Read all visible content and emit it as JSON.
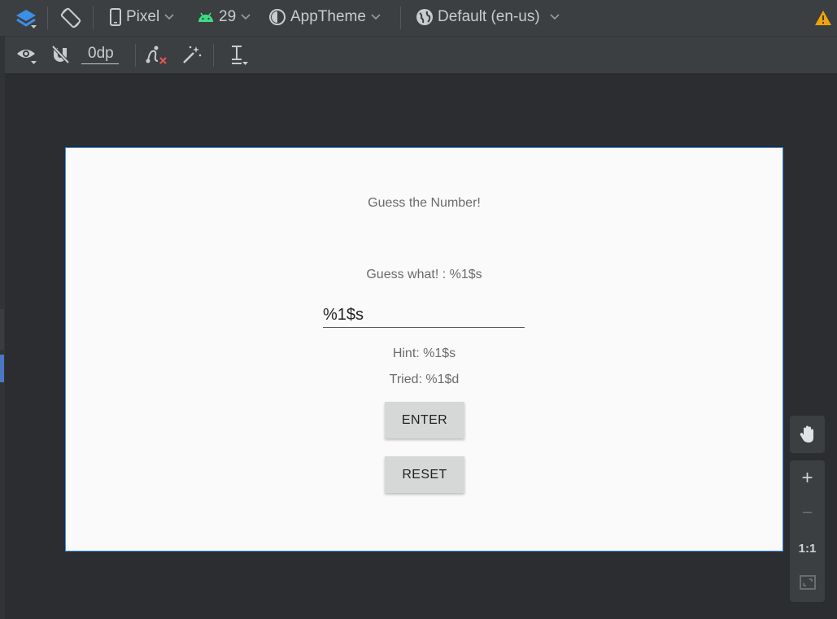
{
  "toolbar": {
    "device": "Pixel",
    "api_level": "29",
    "theme": "AppTheme",
    "locale": "Default (en-us)",
    "margin": "0dp"
  },
  "device_screen": {
    "title": "Guess the Number!",
    "prompt": "Guess what! : %1$s",
    "input_value": "%1$s",
    "hint": "Hint: %1$s",
    "tried": "Tried: %1$d",
    "enter_label": "ENTER",
    "reset_label": "RESET"
  },
  "zoom": {
    "plus": "+",
    "minus": "−",
    "actual_size": "1:1"
  },
  "colors": {
    "accent_blue": "#3b8fe6",
    "android_green": "#3ddc84",
    "warning_orange": "#f0a30a"
  }
}
